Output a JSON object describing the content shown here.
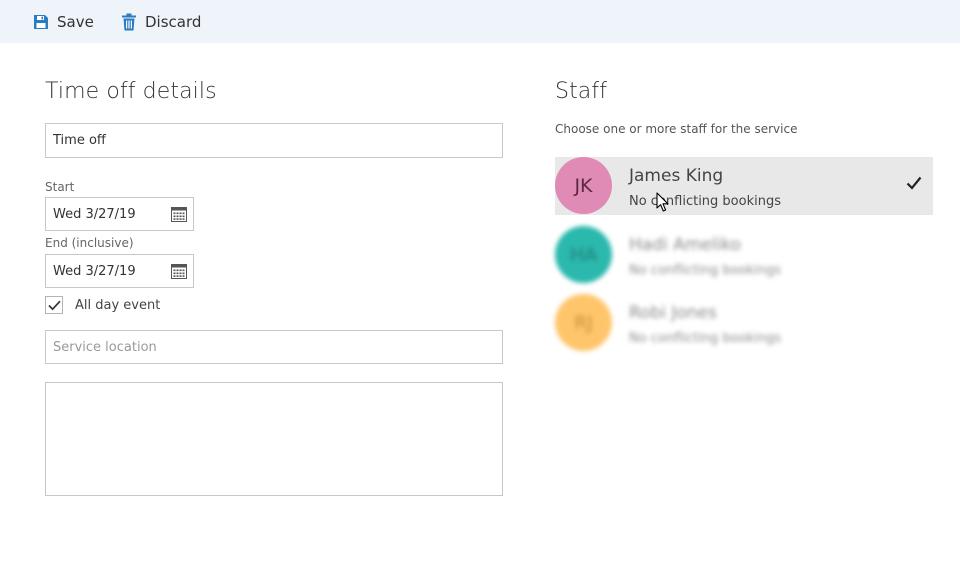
{
  "toolbar": {
    "save_label": "Save",
    "discard_label": "Discard",
    "save_icon": "save-icon",
    "discard_icon": "trash-icon"
  },
  "details": {
    "title": "Time off details",
    "title_field_value": "Time off",
    "start_label": "Start",
    "start_value": "Wed 3/27/19",
    "end_label": "End (inclusive)",
    "end_value": "Wed 3/27/19",
    "all_day_label": "All day event",
    "all_day_checked": true,
    "location_placeholder": "Service location",
    "notes_value": ""
  },
  "staff": {
    "title": "Staff",
    "subtitle": "Choose one or more staff for the service",
    "items": [
      {
        "initials": "JK",
        "name": "James King",
        "status": "No conflicting bookings",
        "color": "#e08bb6",
        "selected": true
      },
      {
        "initials": "HA",
        "name": "Hadi Ameliko",
        "status": "No conflicting bookings",
        "color": "#2bb8ad",
        "selected": false
      },
      {
        "initials": "RJ",
        "name": "Robi Jones",
        "status": "No conflicting bookings",
        "color": "#ffc56b",
        "selected": false
      }
    ]
  },
  "colors": {
    "toolbar_bg": "#eef4fa",
    "accent": "#2b7bc0"
  }
}
